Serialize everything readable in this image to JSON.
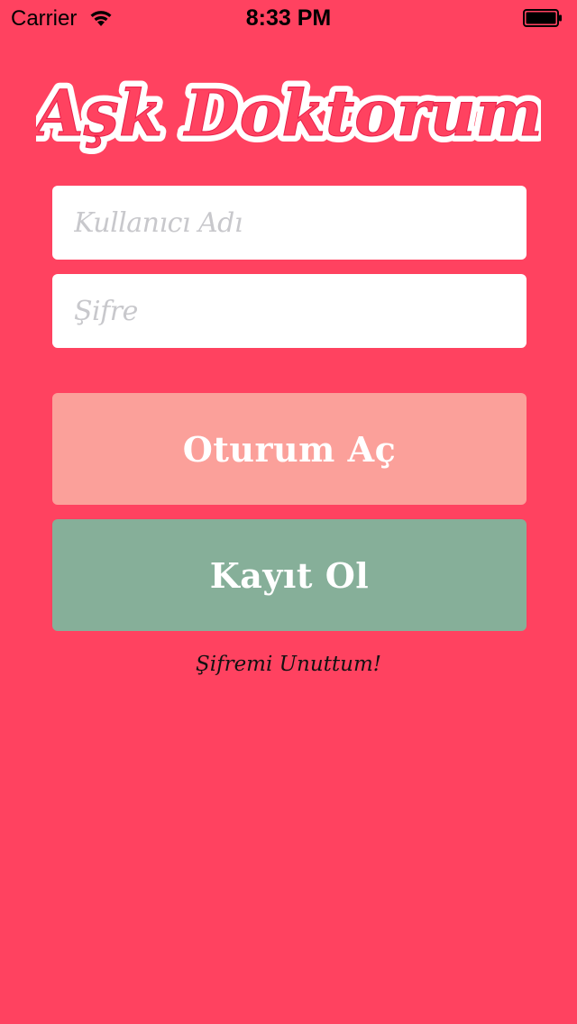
{
  "status_bar": {
    "carrier": "Carrier",
    "time": "8:33 PM"
  },
  "logo": {
    "text": "Aşk Doktorum",
    "fill_color": "#ff4260",
    "outline_color": "#ffffff"
  },
  "login_form": {
    "username_placeholder": "Kullanıcı Adı",
    "password_placeholder": "Şifre",
    "username_value": "",
    "password_value": ""
  },
  "buttons": {
    "login_label": "Oturum Aç",
    "register_label": "Kayıt Ol",
    "forgot_password_label": "Şifremi Unuttum!"
  },
  "colors": {
    "background": "#ff4260",
    "login_button": "#fba09a",
    "register_button": "#86af99"
  }
}
